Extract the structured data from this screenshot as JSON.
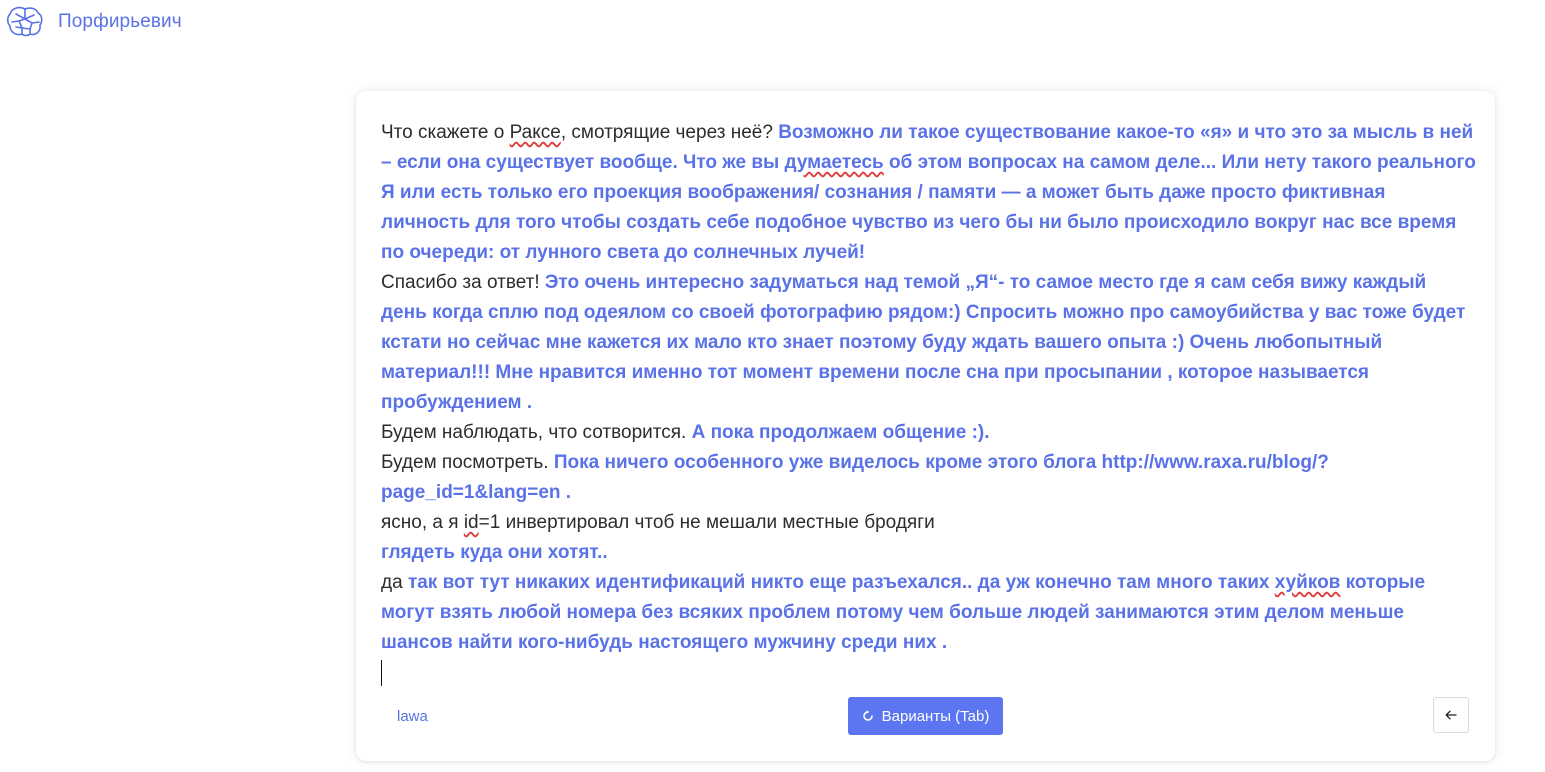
{
  "app": {
    "title": "Порфирьевич",
    "logo_icon": "brain-icon",
    "accent_color": "#5a72e8"
  },
  "editor": {
    "paragraphs": [
      [
        {
          "t": "Что скажете о ",
          "k": "user"
        },
        {
          "t": "Раксе",
          "k": "user",
          "sp": true
        },
        {
          "t": ", смотрящие через неё? ",
          "k": "user"
        },
        {
          "t": "Возможно ли такое существование какое-то «я» и что это за мысль в ней – если она существует вообще. Что же вы ",
          "k": "ai"
        },
        {
          "t": "думаетесь",
          "k": "ai",
          "sp": true
        },
        {
          "t": " об этом вопросах на самом деле... Или нету такого реального Я или есть только его проекция воображения/ сознания / памяти — а может быть даже просто фиктивная личность для того чтобы создать себе подобное чувство из чего бы ни было происходило вокруг нас все время по очереди: от лунного света до солнечных лучей!",
          "k": "ai"
        }
      ],
      [
        {
          "t": "Спасибо за ответ! ",
          "k": "user"
        },
        {
          "t": "Это очень интересно задуматься над темой „Я“- то самое место где я сам себя вижу каждый день когда сплю под одеялом со своей фотографию рядом:) Спросить можно про самоубийства у вас тоже будет кстати но сейчас мне кажется их мало кто знает поэтому буду ждать вашего опыта :) Очень любопытный материал!!! Мне нравится именно тот момент времени после сна при просыпании , которое называется пробуждением .",
          "k": "ai"
        }
      ],
      [
        {
          "t": "Будем наблюдать, что сотворится. ",
          "k": "user"
        },
        {
          "t": "А пока продолжаем общение :).",
          "k": "ai"
        }
      ],
      [
        {
          "t": "Будем посмотреть. ",
          "k": "user"
        },
        {
          "t": "Пока ничего особенного уже виделось кроме этого блога http://www.raxa.ru/blog/?page_id=1&lang=en .",
          "k": "ai"
        }
      ],
      [
        {
          "t": "ясно, а я ",
          "k": "user"
        },
        {
          "t": "id",
          "k": "user",
          "sp": true
        },
        {
          "t": "=1 инвертировал чтоб не мешали местные бродяги",
          "k": "user"
        }
      ],
      [
        {
          "t": " глядеть куда они хотят..",
          "k": "ai"
        }
      ],
      [
        {
          "t": "да ",
          "k": "user"
        },
        {
          "t": "так вот тут никаких идентификаций никто еще разъехался.. да уж конечно там много таких ",
          "k": "ai"
        },
        {
          "t": "хуйков",
          "k": "ai",
          "sp": true
        },
        {
          "t": " которые могут взять любой номера без всяких проблем потому чем больше людей занимаются этим делом меньше шансов найти кого-нибудь настоящего мужчину среди них .",
          "k": "ai"
        }
      ]
    ]
  },
  "footer": {
    "author": "lawa",
    "variants_button": "Варианты (Tab)",
    "variants_icon": "refresh-icon",
    "back_icon": "arrow-left-icon"
  }
}
